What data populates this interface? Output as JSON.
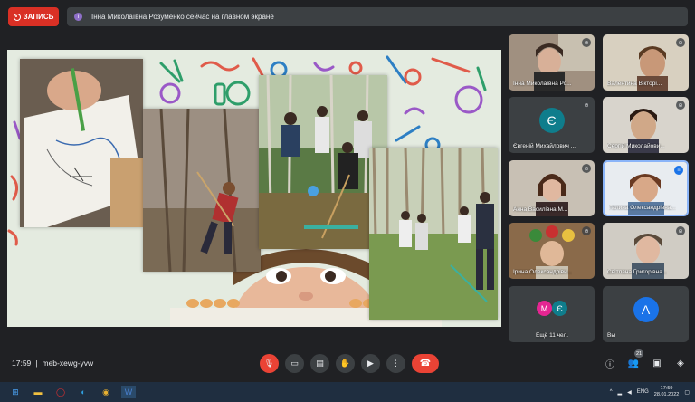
{
  "recording": {
    "label": "ЗАПИСЬ"
  },
  "presenting": {
    "text": "Інна Миколаївна Розуменко сейчас на главном экране"
  },
  "participants": [
    {
      "name": "Інна Миколаївна Ро...",
      "type": "video"
    },
    {
      "name": "Валентина Вікторі...",
      "type": "video"
    },
    {
      "name": "Євгеній Михайлович ...",
      "type": "avatar",
      "initial": "Є",
      "color": "#0f7d8c"
    },
    {
      "name": "Сергій Миколайови...",
      "type": "video"
    },
    {
      "name": "Анна Василівна М...",
      "type": "video"
    },
    {
      "name": "Галина Олександрівна...",
      "type": "video"
    },
    {
      "name": "Ірина Олександрівн...",
      "type": "video"
    },
    {
      "name": "Світлана Григорівна...",
      "type": "video"
    }
  ],
  "more": {
    "label": "Ещё 11 чел.",
    "initials": [
      "М",
      "Є"
    ]
  },
  "self": {
    "name": "Вы",
    "initial": "А"
  },
  "meeting": {
    "time": "17:59",
    "separator": "|",
    "code": "meb-xewg-yvw"
  },
  "people_count": "21",
  "taskbar": {
    "lang": "ENG",
    "clock_time": "17:59",
    "clock_date": "28.01.2022"
  },
  "colors": {
    "accent": "#1a73e8",
    "danger": "#ea4335",
    "tile": "#3c4043",
    "background": "#202124"
  }
}
